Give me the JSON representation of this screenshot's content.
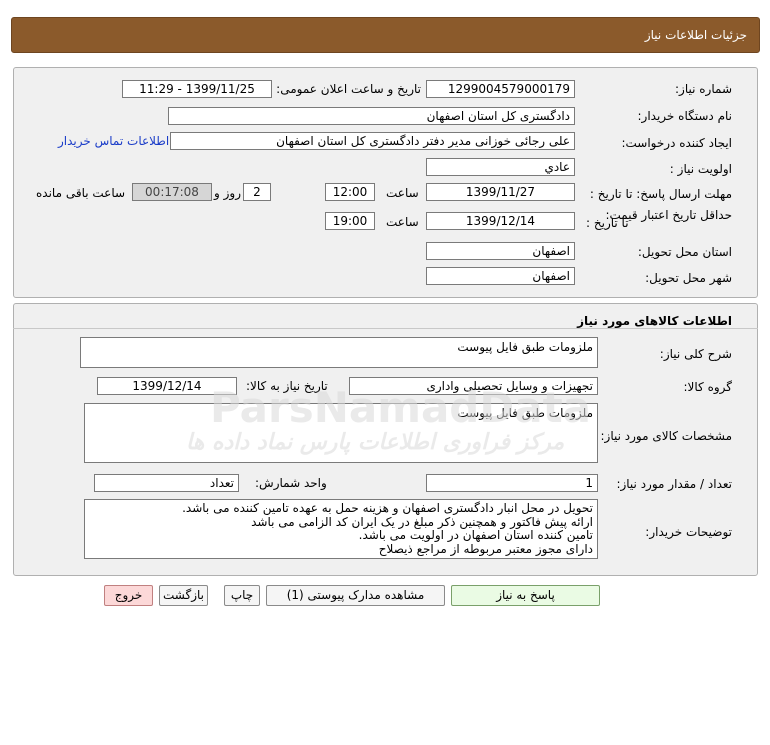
{
  "header": {
    "title": "جزئیات اطلاعات نیاز"
  },
  "need": {
    "number_label": "شماره نیاز:",
    "number_value": "1299004579000179",
    "announce_label": "تاریخ و ساعت اعلان عمومی:",
    "announce_value": "1399/11/25 - 11:29",
    "buyer_org_label": "نام دستگاه خریدار:",
    "buyer_org_value": "دادگستری کل استان اصفهان",
    "requester_label": "ایجاد کننده درخواست:",
    "requester_value": "علی رجائی خوزانی مدیر دفتر دادگستری کل استان اصفهان",
    "contact_link": "اطلاعات تماس خریدار",
    "priority_label": "اولویت نیاز :",
    "priority_value": "عادي",
    "send_deadline_label": "مهلت ارسال پاسخ: تا تاریخ :",
    "send_date": "1399/11/27",
    "time_label": "ساعت",
    "send_time": "12:00",
    "days_count": "2",
    "days_label": "روز و",
    "remaining_time": "00:17:08",
    "remaining_label": "ساعت باقی مانده",
    "price_validity_label": "حداقل تاریخ اعتبار قیمت:",
    "price_validity_to": "تا تاریخ :",
    "validity_date": "1399/12/14",
    "validity_time_label": "ساعت",
    "validity_time": "19:00",
    "province_label": "استان محل تحویل:",
    "province_value": "اصفهان",
    "city_label": "شهر محل تحویل:",
    "city_value": "اصفهان"
  },
  "goods": {
    "section_title": "اطلاعات کالاهای مورد نیاز",
    "desc_label": "شرح کلی نیاز:",
    "desc_value": "ملزومات طبق فایل پیوست",
    "group_label": "گروه کالا:",
    "group_value": "تجهیزات و وسایل تحصیلی واداری",
    "need_date_label": "تاریخ نیاز به کالا:",
    "need_date_value": "1399/12/14",
    "spec_label": "مشخصات کالای مورد نیاز:",
    "spec_value": "ملزومات طبق فایل پیوست",
    "qty_label": "تعداد / مقدار مورد نیاز:",
    "qty_value": "1",
    "unit_label": "واحد شمارش:",
    "unit_value": "تعداد",
    "notes_label": "توضیحات خریدار:",
    "notes_lines": {
      "l1": "تحویل در محل انبار دادگستری اصفهان و هزینه حمل به عهده تامین کننده می باشد.",
      "l2": "ارائه پیش فاکتور و همچنین ذکر مبلغ در یک ایران کد الزامی می باشد",
      "l3": "تامین کننده استان اصفهان در اولویت می باشد.",
      "l4": "دارای مجوز معتبر مربوطه از مراجع ذیصلاح"
    }
  },
  "buttons": {
    "reply": "پاسخ به نیاز",
    "attachments": "مشاهده مدارک پیوستی (1)",
    "print": "چاپ",
    "back": "بازگشت",
    "exit": "خروج"
  },
  "watermark": {
    "text1": "ParsNamadData",
    "text2": "مرکز فراوری اطلاعات پارس نماد داده ها"
  },
  "colors": {
    "header_bg": "#8b5a2b",
    "link": "#1a3cc8",
    "exit_btn": "#fcd8d8",
    "reply_btn": "#eafbe4"
  }
}
